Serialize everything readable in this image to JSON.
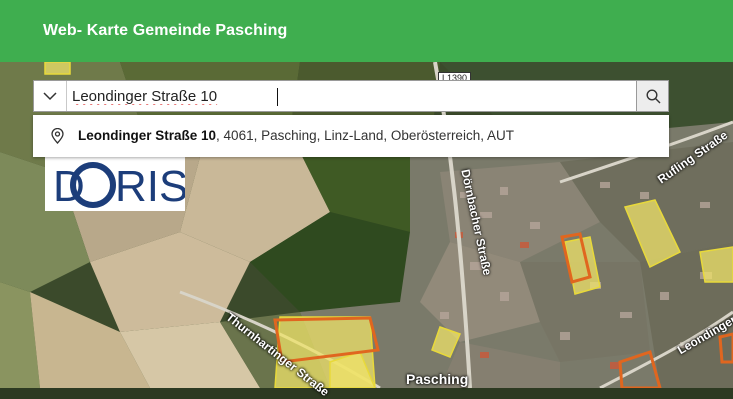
{
  "header": {
    "title": "Web- Karte Gemeinde Pasching",
    "bg": "#3fae4f"
  },
  "search": {
    "value": "Leondinger Straße 10",
    "icons": {
      "dropdown": "chevron-down-icon",
      "clear": "close-icon",
      "go": "search-icon"
    }
  },
  "suggestions": [
    {
      "bold": "Leondinger Straße 10",
      "rest": ", 4061, Pasching, Linz-Land, Oberösterreich, AUT",
      "icon": "map-pin-icon"
    }
  ],
  "logo": {
    "text": "DORIS"
  },
  "map": {
    "labels": {
      "road_sign": "L1390",
      "doernbacher": "Dörnbacher Straße",
      "rufling": "Rufling Straße",
      "thurnharting": "Thurnhartinger Straße",
      "leondinger": "Leondinger",
      "pasching": "Pasching"
    }
  }
}
